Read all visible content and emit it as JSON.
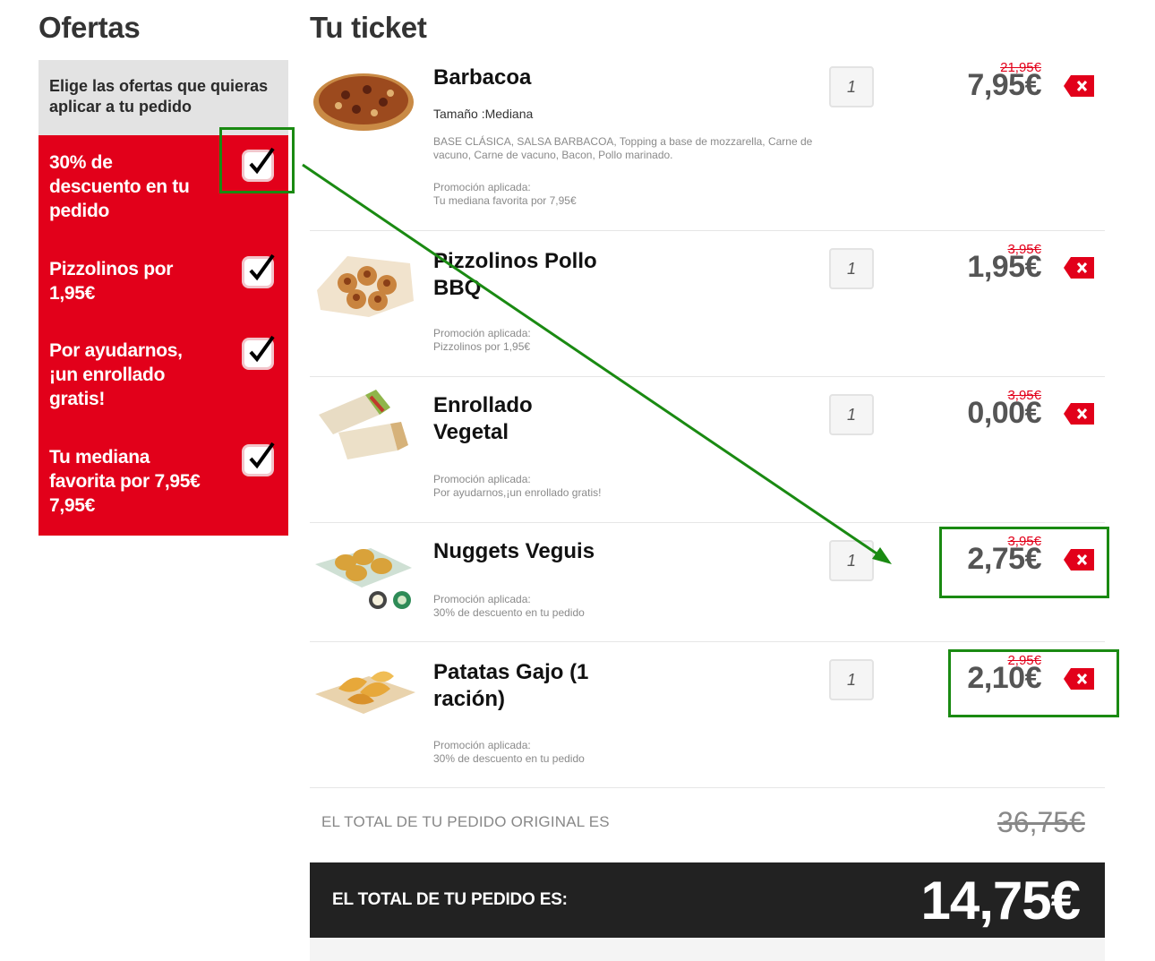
{
  "offers": {
    "title": "Ofertas",
    "intro": "Elige las ofertas que quieras aplicar a tu pedido",
    "items": [
      {
        "label": "30% de descuento en tu pedido",
        "checked": true
      },
      {
        "label": "Pizzolinos por 1,95€",
        "checked": true
      },
      {
        "label": "Por ayudarnos, ¡un enrollado gratis!",
        "checked": true
      },
      {
        "label": "Tu mediana favorita por 7,95€ 7,95€",
        "checked": true
      }
    ]
  },
  "ticket": {
    "title": "Tu ticket",
    "promo_prefix": "Promoción aplicada:",
    "items": [
      {
        "name": "Barbacoa",
        "size": "Tamaño :Mediana",
        "description": "BASE CLÁSICA, SALSA BARBACOA, Topping a base de mozzarella, Carne de vacuno, Carne de vacuno, Bacon, Pollo marinado.",
        "promo": "Tu mediana favorita por 7,95€",
        "qty": "1",
        "old_price": "21,95€",
        "price": "7,95€",
        "image": "pizza"
      },
      {
        "name": "Pizzolinos Pollo BBQ",
        "promo": "Pizzolinos por 1,95€",
        "qty": "1",
        "old_price": "3,95€",
        "price": "1,95€",
        "image": "pizzolinos"
      },
      {
        "name": "Enrollado Vegetal",
        "promo": "Por ayudarnos,¡un enrollado gratis!",
        "qty": "1",
        "old_price": "3,95€",
        "price": "0,00€",
        "image": "wrap"
      },
      {
        "name": "Nuggets Veguis",
        "promo": "30% de descuento en tu pedido",
        "qty": "1",
        "old_price": "3,95€",
        "price": "2,75€",
        "image": "nuggets"
      },
      {
        "name": "Patatas Gajo (1 ración)",
        "promo": "30% de descuento en tu pedido",
        "qty": "1",
        "old_price": "2,95€",
        "price": "2,10€",
        "image": "wedges"
      }
    ],
    "original_total_label": "EL TOTAL DE TU PEDIDO ORIGINAL ES",
    "original_total": "36,75€",
    "total_label": "EL TOTAL DE TU PEDIDO ES:",
    "total": "14,75€"
  },
  "colors": {
    "brand_red": "#e2001a",
    "annotation_green": "#1a8a12",
    "total_bar": "#222222"
  },
  "icons": {
    "checkbox": "checkmark-icon",
    "remove": "remove-x-icon"
  }
}
